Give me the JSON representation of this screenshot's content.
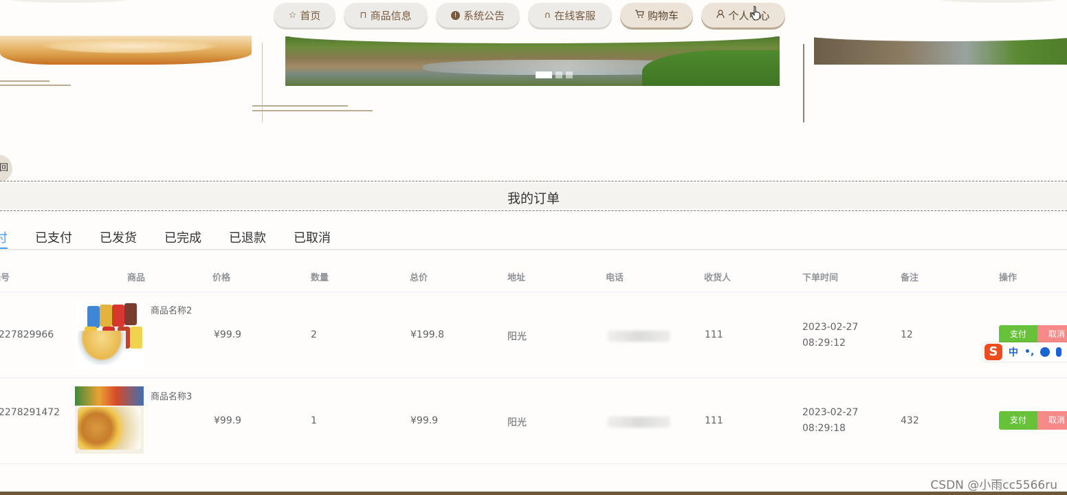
{
  "nav": {
    "items": [
      {
        "label": "首页",
        "icon": "star-icon"
      },
      {
        "label": "商品信息",
        "icon": "shopping-bag-icon"
      },
      {
        "label": "系统公告",
        "icon": "alert-icon"
      },
      {
        "label": "在线客服",
        "icon": "headset-icon"
      },
      {
        "label": "购物车",
        "icon": "cart-icon"
      },
      {
        "label": "个人中心",
        "icon": "user-icon"
      }
    ]
  },
  "back_button": "回",
  "page_title": "我的订单",
  "tabs": [
    "付",
    "已支付",
    "已发货",
    "已完成",
    "已退款",
    "已取消"
  ],
  "table": {
    "headers": [
      "编号",
      "商品",
      "价格",
      "数量",
      "总价",
      "地址",
      "电话",
      "收货人",
      "下单时间",
      "备注",
      "操作"
    ],
    "rows": [
      {
        "id": "227829966",
        "product_name": "商品名称2",
        "price": "¥99.9",
        "quantity": "2",
        "total": "¥199.8",
        "address": "阳光",
        "phone": "",
        "receiver": "111",
        "order_time": "2023-02-27 08:29:12",
        "note": "12"
      },
      {
        "id": "2278291472",
        "product_name": "商品名称3",
        "price": "¥99.9",
        "quantity": "1",
        "total": "¥99.9",
        "address": "阳光",
        "phone": "",
        "receiver": "111",
        "order_time": "2023-02-27 08:29:18",
        "note": "432"
      }
    ],
    "actions": {
      "pay": "支付",
      "cancel": "取消"
    }
  },
  "ime": {
    "logo": "S",
    "mode": "中",
    "punct": "•,"
  },
  "watermark": "CSDN @小雨cc5566ru",
  "colors": {
    "accent": "#409eff",
    "pay": "#67c23a",
    "cancel": "#f78989",
    "nav_text": "#7a5a3e"
  }
}
